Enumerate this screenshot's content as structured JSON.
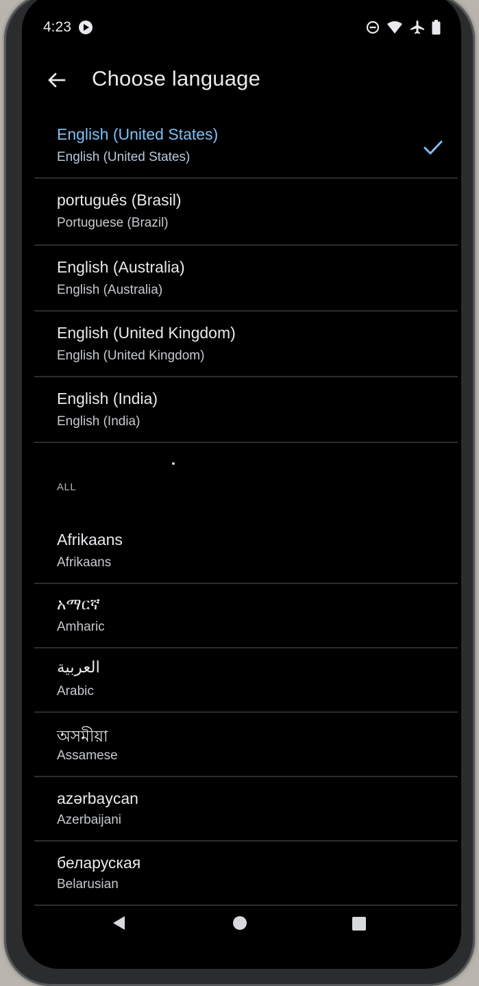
{
  "status_bar": {
    "time": "4:23",
    "icons": [
      "media-playing-icon",
      "do-not-disturb-icon",
      "wifi-icon",
      "airplane-mode-icon",
      "battery-icon"
    ]
  },
  "header": {
    "title": "Choose language",
    "back_icon": "back-arrow-icon"
  },
  "suggested": [
    {
      "native": "English (United States)",
      "english": "English (United States)",
      "selected": true
    },
    {
      "native": "português (Brasil)",
      "english": "Portuguese (Brazil)",
      "selected": false
    },
    {
      "native": "English (Australia)",
      "english": "English (Australia)",
      "selected": false
    },
    {
      "native": "English (United Kingdom)",
      "english": "English (United Kingdom)",
      "selected": false
    },
    {
      "native": "English (India)",
      "english": "English (India)",
      "selected": false
    }
  ],
  "all_section": {
    "header": "ALL",
    "items": [
      {
        "native": "Afrikaans",
        "english": "Afrikaans"
      },
      {
        "native": "አማርኛ",
        "english": "Amharic"
      },
      {
        "native": "العربية",
        "english": "Arabic"
      },
      {
        "native": "অসমীয়া",
        "english": "Assamese"
      },
      {
        "native": "azərbaycan",
        "english": "Azerbaijani"
      },
      {
        "native": "беларуская",
        "english": "Belarusian"
      }
    ]
  },
  "nav_bar": {
    "icons": [
      "nav-back-icon",
      "nav-home-icon",
      "nav-recents-icon"
    ]
  },
  "colors": {
    "background": "#000000",
    "selected_accent": "#7cc0f6",
    "divider": "#2b2d30",
    "text_primary": "#e8eaed"
  }
}
